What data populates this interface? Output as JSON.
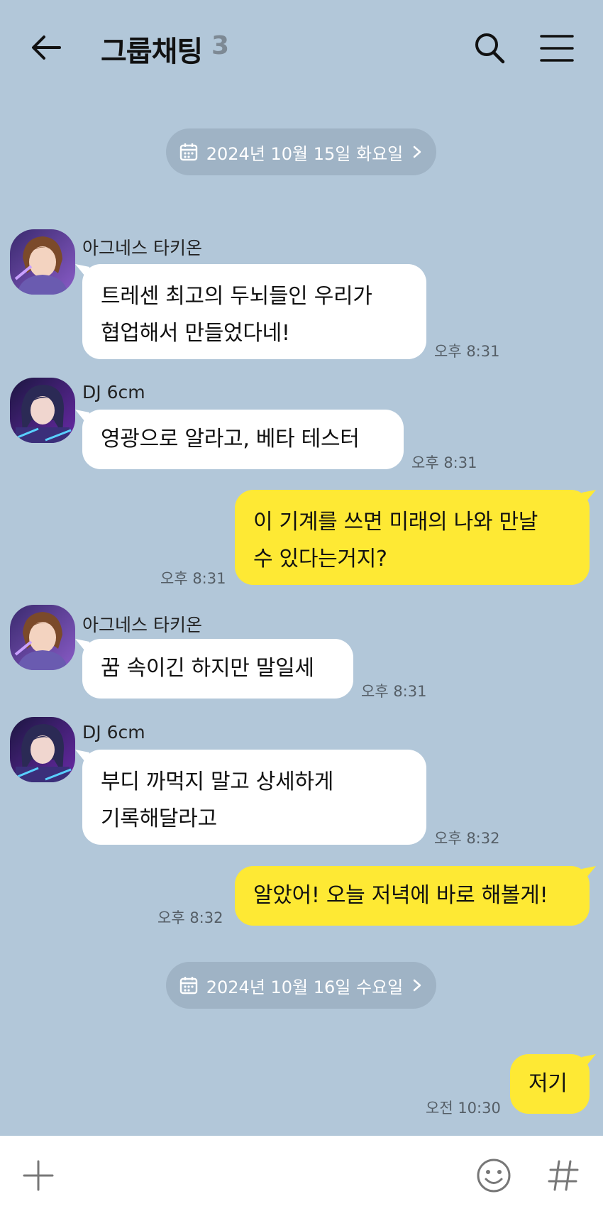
{
  "header": {
    "title": "그룹채팅",
    "member_count": "3"
  },
  "dates": [
    {
      "label": "2024년 10월 15일 화요일"
    },
    {
      "label": "2024년 10월 16일 수요일"
    }
  ],
  "messages": [
    {
      "sender": "아그네스 타키온",
      "lines": [
        "트레센 최고의 두뇌들인 우리가",
        "협업해서 만들었다네!"
      ],
      "time": "오후 8:31"
    },
    {
      "sender": "DJ 6cm",
      "lines": [
        "영광으로 알라고, 베타 테스터"
      ],
      "time": "오후 8:31"
    },
    {
      "sender": "",
      "lines": [
        "이 기계를 쓰면 미래의 나와 만날",
        "수 있다는거지?"
      ],
      "time": "오후 8:31"
    },
    {
      "sender": "아그네스 타키온",
      "lines": [
        "꿈 속이긴 하지만 말일세"
      ],
      "time": "오후 8:31"
    },
    {
      "sender": "DJ 6cm",
      "lines": [
        "부디 까먹지 말고 상세하게",
        "기록해달라고"
      ],
      "time": "오후 8:32"
    },
    {
      "sender": "",
      "lines": [
        "알았어! 오늘 저녁에 바로 해볼게!"
      ],
      "time": "오후 8:32"
    },
    {
      "sender": "",
      "lines": [
        "저기"
      ],
      "time": "오전 10:30"
    }
  ],
  "colors": {
    "background": "#b2c7d9",
    "incoming_bubble": "#ffffff",
    "outgoing_bubble": "#fee934",
    "date_pill": "#9fb3c5"
  },
  "icons": {
    "back": "arrow-left-icon",
    "search": "search-icon",
    "menu": "hamburger-menu-icon",
    "calendar": "calendar-icon",
    "chevron": "chevron-right-icon",
    "plus": "plus-icon",
    "emoji": "emoji-icon",
    "hashtag": "hashtag-icon"
  }
}
